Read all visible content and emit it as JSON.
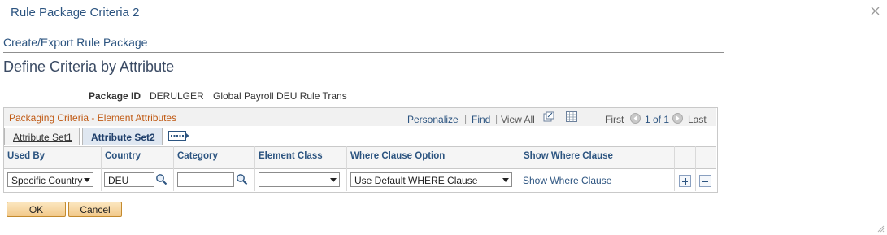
{
  "window": {
    "title": "Rule Package Criteria 2",
    "close_icon": "close-icon"
  },
  "breadcrumb": "Create/Export Rule Package",
  "page_title": "Define Criteria by Attribute",
  "package": {
    "label": "Package ID",
    "id": "DERULGER",
    "description": "Global Payroll DEU Rule Trans"
  },
  "grid": {
    "title": "Packaging Criteria - Element Attributes",
    "personalize": "Personalize",
    "find": "Find",
    "sep": "|",
    "view_all": "View All",
    "first": "First",
    "range": "1 of 1",
    "last": "Last",
    "tabs": [
      {
        "label": "Attribute Set1"
      },
      {
        "label": "Attribute Set2"
      }
    ],
    "columns": {
      "used_by": "Used By",
      "country": "Country",
      "category": "Category",
      "element_class": "Element Class",
      "where_option": "Where Clause Option",
      "show_where": "Show Where Clause"
    },
    "row": {
      "used_by": "Specific Country",
      "country": "DEU",
      "category": "",
      "element_class": "",
      "where_option": "Use Default WHERE Clause",
      "show_where": "Show Where Clause"
    }
  },
  "buttons": {
    "ok": "OK",
    "cancel": "Cancel"
  },
  "colors": {
    "link": "#2c5480",
    "grid_title": "#c05a14",
    "button_border": "#c48a2d"
  }
}
